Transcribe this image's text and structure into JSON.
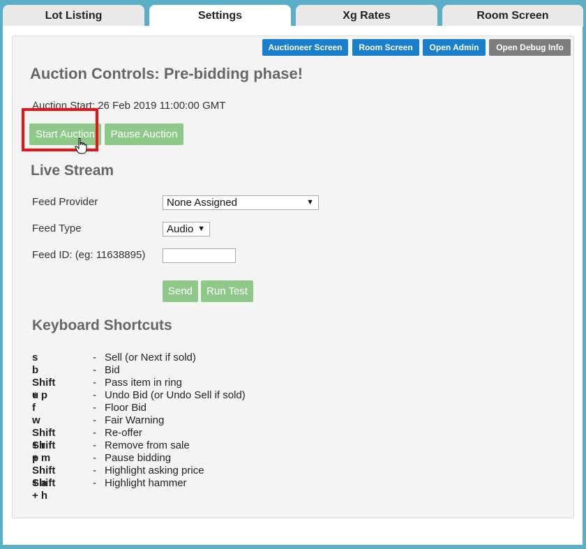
{
  "tabs": [
    {
      "label": "Lot Listing",
      "active": false
    },
    {
      "label": "Settings",
      "active": true
    },
    {
      "label": "Xg Rates",
      "active": false
    },
    {
      "label": "Room Screen",
      "active": false
    }
  ],
  "toolbar": {
    "auctioneer_screen": "Auctioneer Screen",
    "room_screen": "Room Screen",
    "open_admin": "Open Admin",
    "open_debug_info": "Open Debug Info"
  },
  "auction": {
    "title": "Auction Controls: Pre-bidding phase!",
    "start_label": "Auction Start:",
    "start_value": "26 Feb 2019 11:00:00 GMT",
    "start_button": "Start Auction",
    "pause_button": "Pause Auction"
  },
  "live_stream": {
    "title": "Live Stream",
    "feed_provider_label": "Feed Provider",
    "feed_provider_value": "None Assigned",
    "feed_type_label": "Feed Type",
    "feed_type_value": "Audio",
    "feed_id_label": "Feed ID: (eg: 11638895)",
    "feed_id_value": "",
    "send_button": "Send",
    "run_test_button": "Run Test"
  },
  "shortcuts": {
    "title": "Keyboard Shortcuts",
    "separator": "-",
    "items": [
      {
        "key": "s",
        "desc": "Sell (or Next if sold)"
      },
      {
        "key": "b",
        "desc": "Bid"
      },
      {
        "key": "Shift + p",
        "desc": "Pass item in ring"
      },
      {
        "key": "u",
        "desc": "Undo Bid (or Undo Sell if sold)"
      },
      {
        "key": "f",
        "desc": "Floor Bid"
      },
      {
        "key": "w",
        "desc": "Fair Warning"
      },
      {
        "key": "Shift + r",
        "desc": "Re-offer"
      },
      {
        "key": "Shift + m",
        "desc": "Remove from sale"
      },
      {
        "key": "p",
        "desc": "Pause bidding"
      },
      {
        "key": "Shift + a",
        "desc": "Highlight asking price"
      },
      {
        "key": "Shift + h",
        "desc": "Highlight hammer"
      }
    ]
  },
  "colors": {
    "frame": "#5aaec6",
    "primary_button": "#1a7fcc",
    "debug_button": "#7d7d7d",
    "action_button": "#8ec98a",
    "highlight_box": "#ee1111"
  }
}
